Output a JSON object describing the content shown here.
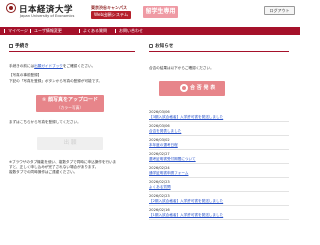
{
  "header": {
    "university_name": "日本経済大学",
    "university_english": "Japan University of Economics",
    "campus": "東京渋谷キャンパス",
    "system_name": "Web出願システム",
    "student_badge": "留学生専用",
    "logout_label": "ログアウト"
  },
  "nav": [
    {
      "label": "マイページ"
    },
    {
      "label": "ユーザ情報変更"
    },
    {
      "label": "よくある質問"
    },
    {
      "label": "お問い合わせ"
    }
  ],
  "left": {
    "title": "手続き",
    "line1_pre": "手続きの前には",
    "line1_link": "出願ガイドブック",
    "line1_post": "をご確認ください。",
    "section_heading": "【写真の事前登録】",
    "line2": "下記の「写真を登録」ボタンから写真の登録が可能です。",
    "photo_button_line1": "① 顔写真をアップロード",
    "photo_button_line2": "（カラー写真）",
    "line3": "まずはこちらから写真を登録してください。",
    "apply_button": "出 願",
    "note1": "※ブラウザのタブ機能を使い、複数タブで同時に申込操作を行いま",
    "note2": "すと、正しく申し込みが完了されない場合があります。",
    "note3": "複数タブでの同時操作はご遠慮ください。"
  },
  "right": {
    "title": "お知らせ",
    "intro": "合否の結果は以下からご確認ください。",
    "result_button": "合 否 発 表",
    "notices": [
      {
        "date": "2026/03/06",
        "title": "【3期入試合格者】入学許可書を発送しました"
      },
      {
        "date": "2026/03/06",
        "title": "合否を発表しました"
      },
      {
        "date": "2026/03/02",
        "title": "本年度の選考日程"
      },
      {
        "date": "2026/02/27",
        "title": "選考証明書受付期間について"
      },
      {
        "date": "2026/02/24",
        "title": "通学証明書申請フォーム"
      },
      {
        "date": "2026/02/23",
        "title": "よくある質問"
      },
      {
        "date": "2026/02/23",
        "title": "【2期入試合格者】入学許可書を発送しました"
      },
      {
        "date": "2026/02/16",
        "title": "【1期入試合格者】入学許可書を発送しました"
      }
    ]
  }
}
